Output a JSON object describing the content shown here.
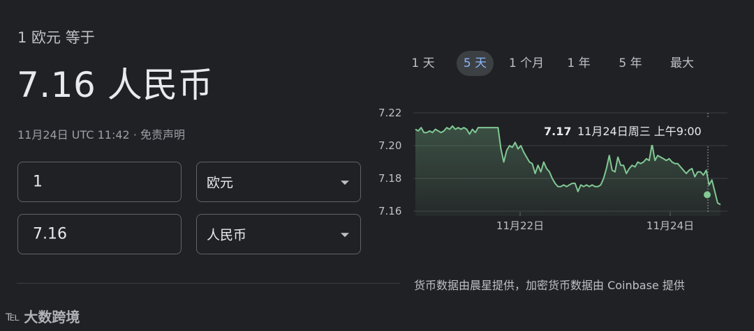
{
  "converter": {
    "header": "1 欧元 等于",
    "result": "7.16 人民币",
    "timestamp": "11月24日 UTC 11:42",
    "separator": "·",
    "disclaimer": "免责声明",
    "amount_from": "1",
    "currency_from": "欧元",
    "amount_to": "7.16",
    "currency_to": "人民币"
  },
  "range_tabs": [
    "1 天",
    "5 天",
    "1 个月",
    "1 年",
    "5 年",
    "最大"
  ],
  "active_tab": "5 天",
  "tooltip": {
    "value": "7.17",
    "date": "11月24日周三 上午9:00"
  },
  "credit": "货币数据由晨星提供，加密货币数据由 Coinbase 提供",
  "watermark": "大数跨境",
  "colors": {
    "background": "#202124",
    "line": "#81c995",
    "active_tab_text": "#8ab4f8"
  },
  "chart_data": {
    "type": "line",
    "ylim": [
      7.155,
      7.222
    ],
    "yticks": [
      "7.22",
      "7.20",
      "7.18",
      "7.16"
    ],
    "xticks": [
      "11月22日",
      "11月24日"
    ],
    "grid": true,
    "series": [
      {
        "values": [
          7.21,
          7.209,
          7.211,
          7.208,
          7.208,
          7.209,
          7.208,
          7.21,
          7.209,
          7.208,
          7.209,
          7.211,
          7.21,
          7.212,
          7.21,
          7.211,
          7.21,
          7.211,
          7.21,
          7.207,
          7.21,
          7.208,
          7.211,
          7.211,
          7.211,
          7.211,
          7.211,
          7.211,
          7.211,
          7.211,
          7.198,
          7.19,
          7.197,
          7.2,
          7.199,
          7.202,
          7.198,
          7.2,
          7.196,
          7.193,
          7.19,
          7.189,
          7.183,
          7.188,
          7.184,
          7.19,
          7.186,
          7.184,
          7.18,
          7.177,
          7.175,
          7.175,
          7.176,
          7.175,
          7.176,
          7.177,
          7.177,
          7.172,
          7.176,
          7.175,
          7.176,
          7.175,
          7.176,
          7.175,
          7.175,
          7.176,
          7.18,
          7.186,
          7.194,
          7.185,
          7.184,
          7.193,
          7.188,
          7.188,
          7.183,
          7.186,
          7.188,
          7.187,
          7.19,
          7.189,
          7.19,
          7.192,
          7.191,
          7.201,
          7.191,
          7.194,
          7.193,
          7.192,
          7.191,
          7.192,
          7.19,
          7.189,
          7.189,
          7.187,
          7.185,
          7.183,
          7.185,
          7.186,
          7.181,
          7.184,
          7.184,
          7.182,
          7.185,
          7.176,
          7.179,
          7.172,
          7.165,
          7.164
        ]
      }
    ]
  }
}
